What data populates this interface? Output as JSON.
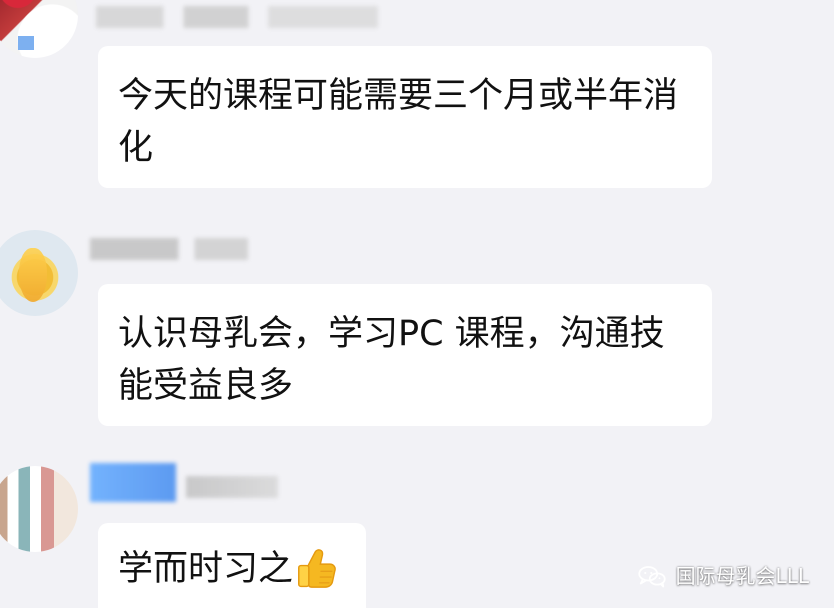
{
  "chat": {
    "messages": [
      {
        "text": "今天的课程可能需要三个月或半年消化"
      },
      {
        "text": "认识母乳会，学习PC 课程，沟通技能受益良多"
      },
      {
        "text": "学而时习之",
        "emoji": "👍",
        "icon": "thumbs-up-icon"
      }
    ]
  },
  "watermark": {
    "text": "国际母乳会LLL",
    "icon": "wechat-icon"
  },
  "colors": {
    "background": "#f2f2f6",
    "bubble": "#ffffff",
    "text": "#111111",
    "thumb": "#f5b821"
  }
}
